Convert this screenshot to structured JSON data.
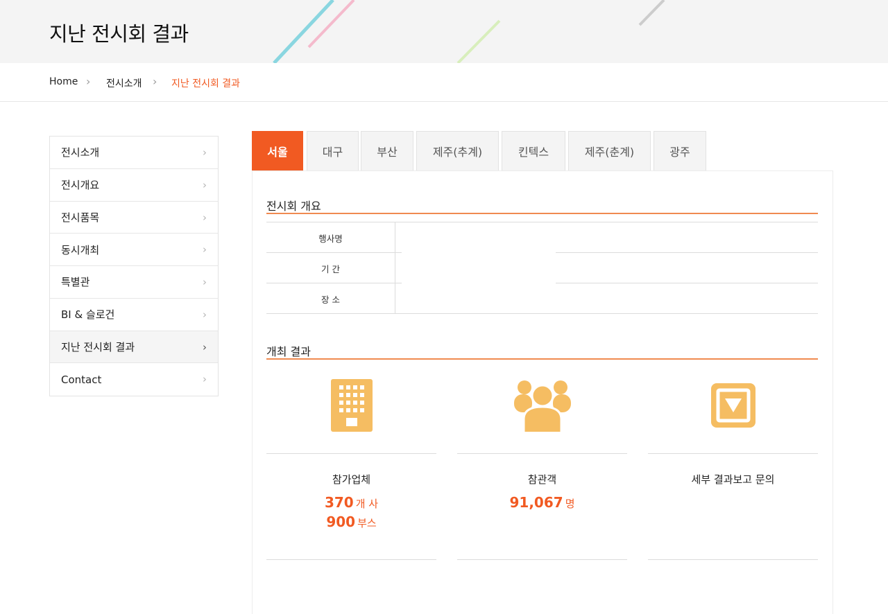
{
  "header": {
    "title": "지난 전시회 결과"
  },
  "breadcrumb": {
    "items": [
      "Home",
      "전시소개",
      "지난 전시회 결과"
    ]
  },
  "sidebar": {
    "items": [
      {
        "label": "전시소개"
      },
      {
        "label": "전시개요"
      },
      {
        "label": "전시품목"
      },
      {
        "label": "동시개최"
      },
      {
        "label": "특별관"
      },
      {
        "label": "BI & 슬로건"
      },
      {
        "label": "지난 전시회 결과"
      },
      {
        "label": "Contact"
      }
    ],
    "active_index": 6
  },
  "tabs": {
    "items": [
      "서울",
      "대구",
      "부산",
      "제주(추계)",
      "킨텍스",
      "제주(춘계)",
      "광주"
    ],
    "active_index": 0
  },
  "overview": {
    "title": "전시회 개요",
    "rows": [
      {
        "label": "행사명",
        "value": ""
      },
      {
        "label": "기 간",
        "value": ""
      },
      {
        "label": "장 소",
        "value": ""
      }
    ]
  },
  "results": {
    "title": "개최 결과",
    "cards": [
      {
        "icon": "building-icon",
        "label": "참가업체",
        "stats": [
          {
            "value": "370",
            "unit": "개 사"
          },
          {
            "value": "900",
            "unit": "부스"
          }
        ]
      },
      {
        "icon": "visitors-icon",
        "label": "참관객",
        "stats": [
          {
            "value": "91,067",
            "unit": "명"
          }
        ]
      },
      {
        "icon": "report-download-icon",
        "label": "세부 결과보고 문의",
        "stats": []
      }
    ]
  },
  "colors": {
    "accent": "#f15a22",
    "icon": "#f5bd62",
    "section_line": "#f08a50"
  }
}
